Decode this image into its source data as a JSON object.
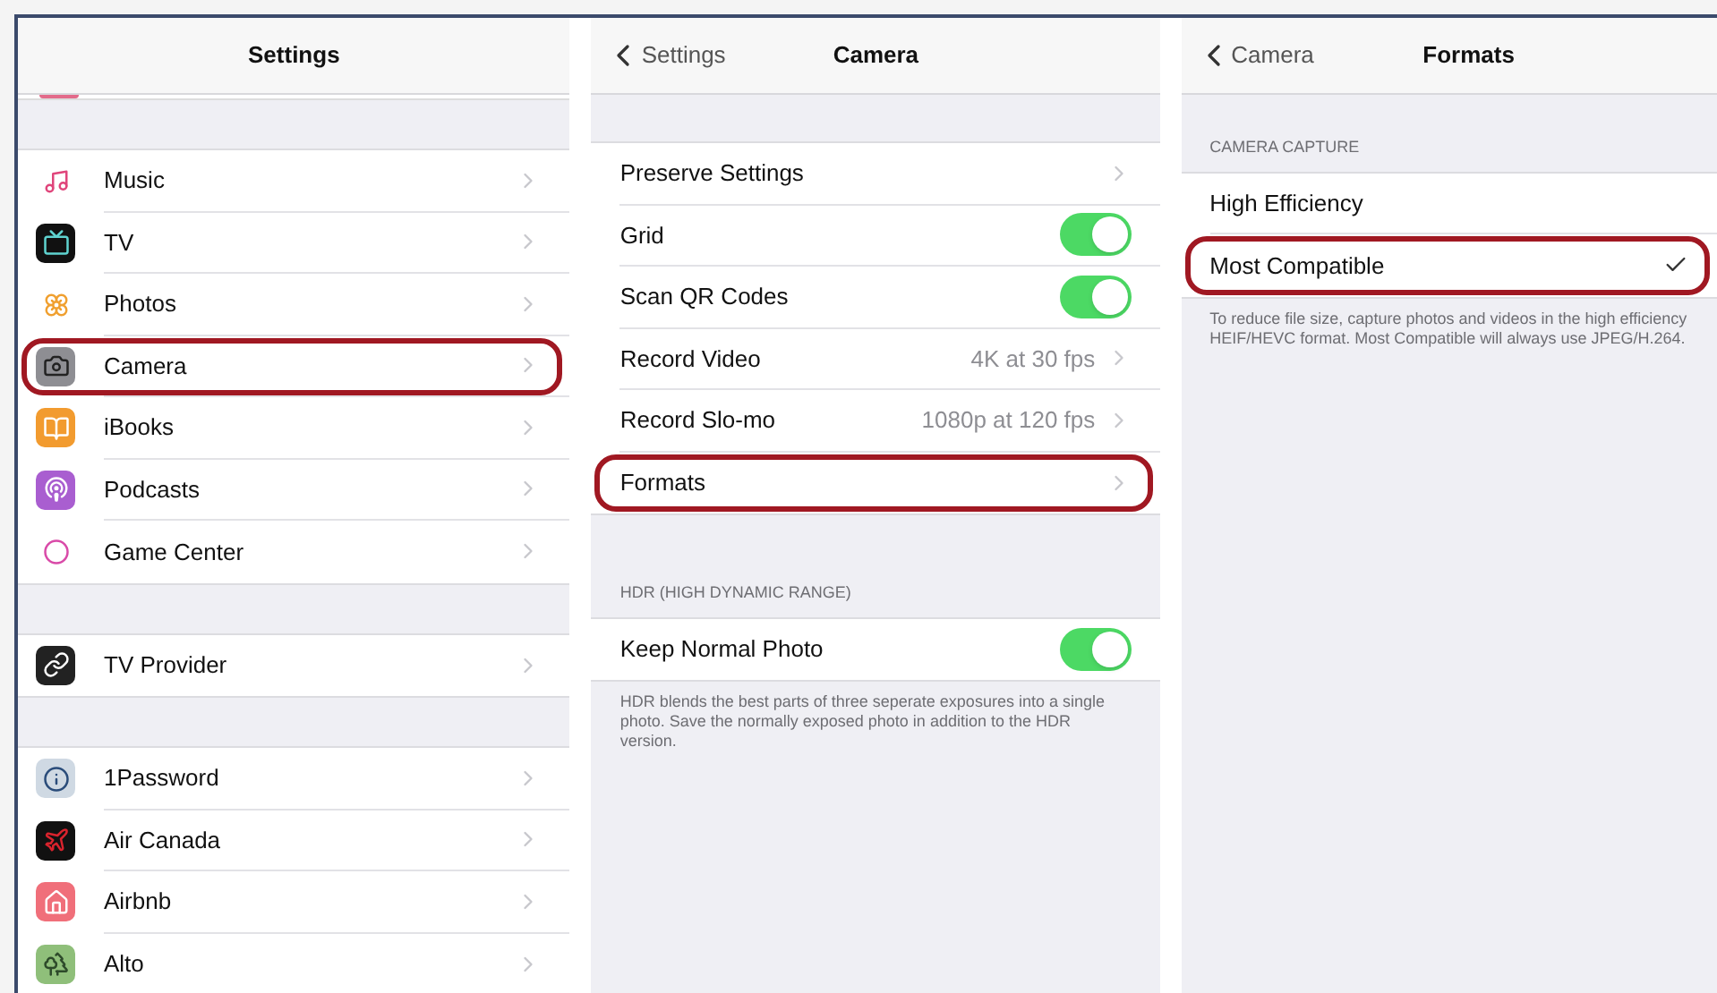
{
  "panels": [
    {
      "title": "Settings",
      "groups": [
        {
          "rows": [
            {
              "kind": "link",
              "label": "Music",
              "highlighted": false
            },
            {
              "kind": "link",
              "label": "TV",
              "highlighted": false
            },
            {
              "kind": "link",
              "label": "Photos",
              "highlighted": false
            },
            {
              "kind": "link",
              "label": "Camera",
              "highlighted": true
            },
            {
              "kind": "link",
              "label": "iBooks",
              "highlighted": false
            },
            {
              "kind": "link",
              "label": "Podcasts",
              "highlighted": false
            },
            {
              "kind": "link",
              "label": "Game Center",
              "highlighted": false
            }
          ]
        },
        {
          "rows": [
            {
              "kind": "link",
              "label": "TV Provider",
              "highlighted": false
            }
          ]
        },
        {
          "rows": [
            {
              "kind": "link",
              "label": "1Password",
              "highlighted": false
            },
            {
              "kind": "link",
              "label": "Air Canada",
              "highlighted": false
            },
            {
              "kind": "link",
              "label": "Airbnb",
              "highlighted": false
            },
            {
              "kind": "link",
              "label": "Alto",
              "highlighted": false
            }
          ]
        }
      ]
    },
    {
      "title": "Camera",
      "back": "Settings",
      "groups": [
        {
          "rows": [
            {
              "kind": "link",
              "label": "Preserve Settings",
              "highlighted": false
            },
            {
              "kind": "toggle",
              "label": "Grid",
              "on": true,
              "highlighted": false
            },
            {
              "kind": "toggle",
              "label": "Scan QR Codes",
              "on": true,
              "highlighted": false
            },
            {
              "kind": "link",
              "label": "Record Video",
              "value": "4K at 30 fps",
              "highlighted": false
            },
            {
              "kind": "link",
              "label": "Record Slo-mo",
              "value": "1080p at 120 fps",
              "highlighted": false
            },
            {
              "kind": "link",
              "label": "Formats",
              "highlighted": true
            }
          ]
        },
        {
          "header": "HDR (HIGH DYNAMIC RANGE)",
          "rows": [
            {
              "kind": "toggle",
              "label": "Keep Normal Photo",
              "on": true,
              "highlighted": false
            }
          ],
          "footer": "HDR blends the best parts of three seperate exposures into a single photo. Save the normally exposed photo in addition to the HDR version."
        }
      ]
    },
    {
      "title": "Formats",
      "back": "Camera",
      "groups": [
        {
          "header": "CAMERA CAPTURE",
          "rows": [
            {
              "kind": "option",
              "label": "High Efficiency",
              "selected": false,
              "highlighted": false
            },
            {
              "kind": "option",
              "label": "Most Compatible",
              "selected": true,
              "highlighted": true
            }
          ],
          "footer": "To reduce file size, capture photos and videos in the high efficiency HEIF/HEVC format. Most Compatible will always use JPEG/H.264."
        }
      ]
    }
  ]
}
